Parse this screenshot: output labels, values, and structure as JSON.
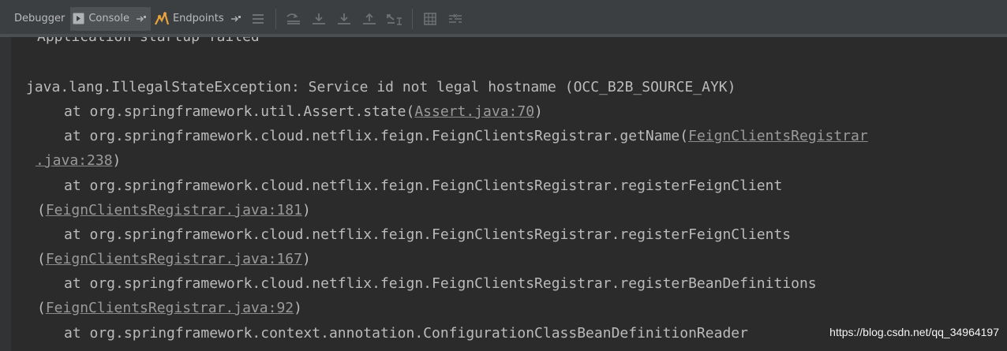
{
  "tabs": {
    "debugger": "Debugger",
    "console": "Console",
    "endpoints": "Endpoints"
  },
  "toolbar_icons": [
    "menu-icon",
    "scroll-to-top-icon",
    "step-over-icon",
    "step-into-icon",
    "step-out-icon",
    "run-to-cursor-icon",
    "evaluate-icon",
    "trace-icon"
  ],
  "console": {
    "status_line": "Application startup failed",
    "exception": "java.lang.IllegalStateException: Service id not legal hostname (OCC_B2B_SOURCE_AYK)",
    "frames": [
      {
        "prefix": "at org.springframework.util.Assert.state(",
        "link": "Assert.java:70",
        "suffix": ")"
      },
      {
        "prefix": "at org.springframework.cloud.netflix.feign.FeignClientsRegistrar.getName(",
        "link_a": "FeignClientsRegistrar",
        "link_b": ".java:238",
        "suffix": ")"
      },
      {
        "prefix": "at org.springframework.cloud.netflix.feign.FeignClientsRegistrar.registerFeignClient",
        "open": "(",
        "link": "FeignClientsRegistrar.java:181",
        "suffix": ")"
      },
      {
        "prefix": "at org.springframework.cloud.netflix.feign.FeignClientsRegistrar.registerFeignClients",
        "open": "(",
        "link": "FeignClientsRegistrar.java:167",
        "suffix": ")"
      },
      {
        "prefix": "at org.springframework.cloud.netflix.feign.FeignClientsRegistrar.registerBeanDefinitions",
        "open": "(",
        "link": "FeignClientsRegistrar.java:92",
        "suffix": ")"
      },
      {
        "prefix": "at org.springframework.context.annotation.ConfigurationClassBeanDefinitionReader"
      }
    ]
  },
  "watermark": "https://blog.csdn.net/qq_34964197",
  "colors": {
    "background": "#2b2b2b",
    "toolbar": "#3c3f41",
    "text": "#bbbbbb",
    "link": "#9a9a9a",
    "endpoints_icon": "#e8a33d"
  }
}
